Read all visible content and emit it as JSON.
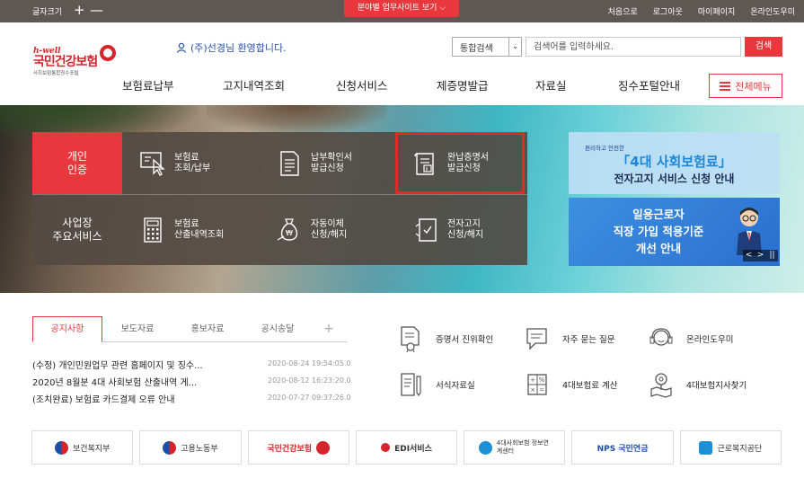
{
  "topbar": {
    "font_size_label": "글자크기",
    "plus": "+",
    "minus": "—",
    "field_site": "분야별 업무사이트 보기 ⌵",
    "links": [
      "처음으로",
      "로그아웃",
      "마이페이지",
      "온라인도우미"
    ]
  },
  "logo": {
    "tagline": "h-well",
    "name": "국민건강보험",
    "sub": "사회보험통합징수포털"
  },
  "welcome": "(주)선경님 환영합니다.",
  "search": {
    "scope": "통합검색",
    "placeholder": "검색어를 입력하세요.",
    "button": "검색"
  },
  "gnb": [
    "보험료납부",
    "고지내역조회",
    "신청서비스",
    "제증명발급",
    "자료실",
    "징수포털안내"
  ],
  "menu_all": "전체메뉴",
  "hero": {
    "personal_auth": "개인\n인증",
    "business_services": "사업장\n주요서비스",
    "personal_items": [
      {
        "icon": "cursor-screen-icon",
        "label": "보험료\n조회/납부"
      },
      {
        "icon": "document-icon",
        "label": "납부확인서\n발급신청"
      },
      {
        "icon": "certificate-icon",
        "label": "완납증명서\n발급신청"
      }
    ],
    "business_items": [
      {
        "icon": "calculator-icon",
        "label": "보험료\n산출내역조회"
      },
      {
        "icon": "money-bag-icon",
        "label": "자동이체\n신청/해지"
      },
      {
        "icon": "e-bill-icon",
        "label": "전자고지\n신청/해지"
      }
    ]
  },
  "banner1": {
    "small": "편리하고 안전한",
    "big": "「4대 사회보험료」",
    "sub": "전자고지 서비스 신청 안내"
  },
  "banner2": {
    "line1": "일용근로자",
    "line2": "직장 가입 적용기준",
    "line3": "개선 안내",
    "prev": "<",
    "next": ">",
    "pause": "||"
  },
  "tabs": [
    "공지사항",
    "보도자료",
    "홍보자료",
    "공시송달"
  ],
  "tabs_plus": "+",
  "news": [
    {
      "title": "(수정) 개인민원업무 관련 홈페이지 및 징수...",
      "date": "2020-08-24 19:54:05.0"
    },
    {
      "title": "2020년 8월분 4대 사회보험 산출내역 게...",
      "date": "2020-08-12 16:23:20.0"
    },
    {
      "title": "(조치완료) 보험료 카드결제 오류 안내",
      "date": "2020-07-27 09:37:26.0"
    }
  ],
  "quick_links": [
    {
      "icon": "certificate-verify-icon",
      "label": "증명서 진위확인"
    },
    {
      "icon": "faq-chat-icon",
      "label": "자주 묻는 질문"
    },
    {
      "icon": "headset-icon",
      "label": "온라인도우미"
    },
    {
      "icon": "form-document-icon",
      "label": "서식자료실"
    },
    {
      "icon": "calculator-icon",
      "label": "4대보험료 계산"
    },
    {
      "icon": "map-pin-icon",
      "label": "4대보험지사찾기"
    }
  ],
  "footer_logos": [
    {
      "label": "보건복지부",
      "color": "#1d4fa8"
    },
    {
      "label": "고용노동부",
      "color": "#1d4fa8"
    },
    {
      "label": "국민건강보험",
      "color": "#d3252b"
    },
    {
      "label": "EDI서비스",
      "color": "#d3252b"
    },
    {
      "label": "4대사회보험 정보연계센터",
      "color": "#1c8fd6"
    },
    {
      "label": "NPS 국민연금",
      "color": "#1d4fa8"
    },
    {
      "label": "근로복지공단",
      "color": "#1c8fd6"
    }
  ],
  "colors": {
    "accent": "#e8383d",
    "topbar": "#5f5753",
    "panel": "#534a43",
    "highlight": "#e32b24"
  }
}
